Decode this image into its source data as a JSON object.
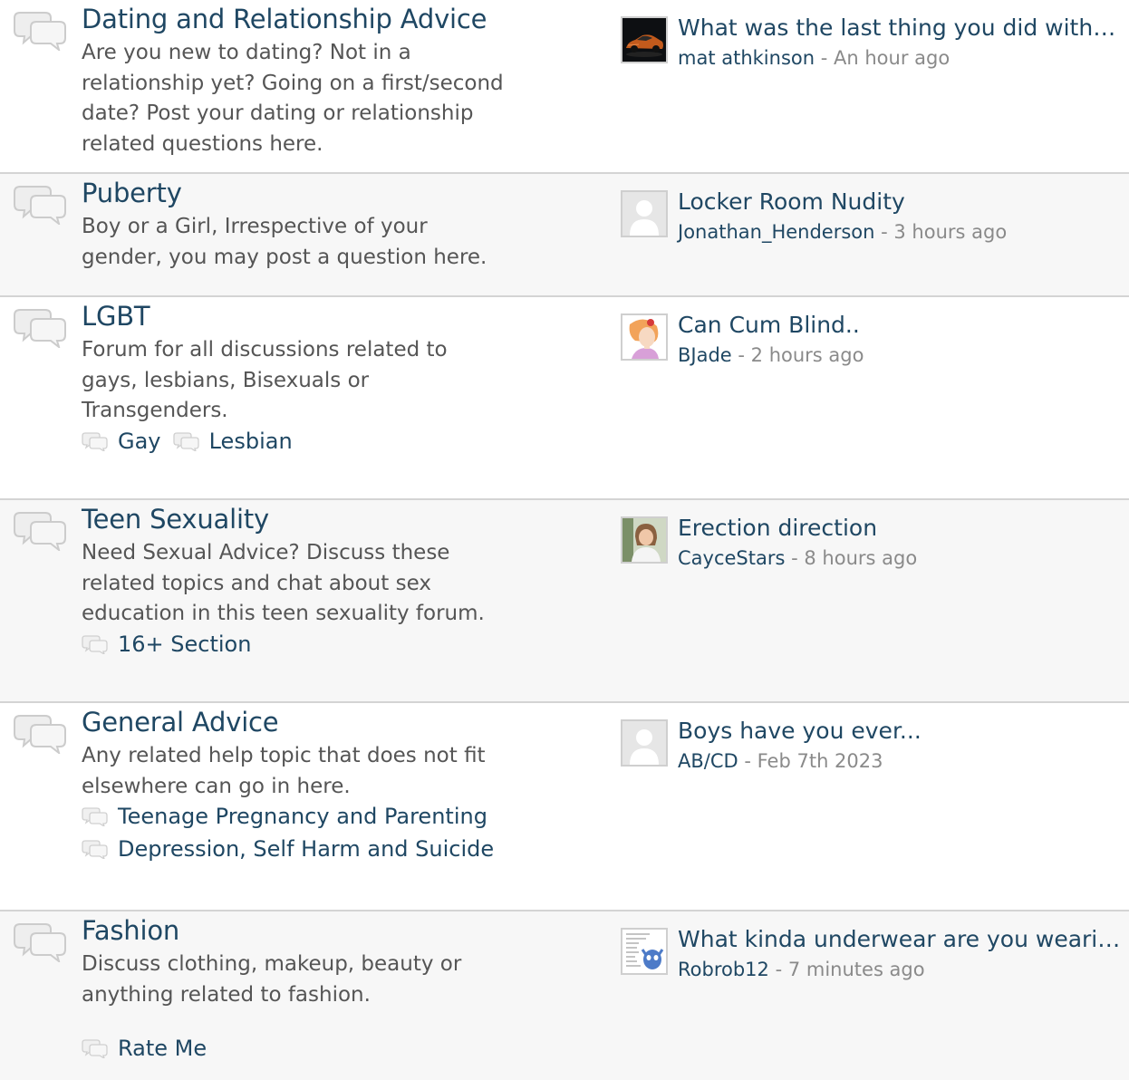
{
  "forums": [
    {
      "title": "Dating and Relationship Advice",
      "description": "Are you new to dating? Not in a relationship yet? Going on a first/second date? Post your dating or relationship related questions here.",
      "subforums": [],
      "last_post": {
        "title": "What was the last thing you did with yo...",
        "user": "mat athkinson",
        "separator": " - ",
        "time": "An hour ago",
        "avatar": "car-avatar"
      }
    },
    {
      "title": "Puberty",
      "description": "Boy or a Girl, Irrespective of your gender, you may post a question here.",
      "subforums": [],
      "last_post": {
        "title": "Locker Room Nudity",
        "user": "Jonathan_Henderson",
        "separator": " - ",
        "time": "3 hours ago",
        "avatar": "default-avatar"
      }
    },
    {
      "title": "LGBT",
      "description": "Forum for all discussions related to gays, lesbians, Bisexuals or Transgenders.",
      "subforums": [
        "Gay",
        "Lesbian"
      ],
      "last_post": {
        "title": "Can Cum Blind..",
        "user": "BJade",
        "separator": " - ",
        "time": "2 hours ago",
        "avatar": "cartoon-avatar"
      }
    },
    {
      "title": "Teen Sexuality",
      "description": "Need Sexual Advice? Discuss these related topics and chat about sex education in this teen sexuality forum.",
      "subforums": [
        "16+ Section"
      ],
      "last_post": {
        "title": "Erection direction",
        "user": "CayceStars",
        "separator": " - ",
        "time": "8 hours ago",
        "avatar": "photo-avatar"
      }
    },
    {
      "title": "General Advice",
      "description": "Any related help topic that does not fit elsewhere can go in here.",
      "subforums": [
        "Teenage Pregnancy and Parenting",
        "Depression, Self Harm and Suicide"
      ],
      "last_post": {
        "title": "Boys have you ever...",
        "user": "AB/CD",
        "separator": " - ",
        "time": "Feb 7th 2023",
        "avatar": "default-avatar"
      }
    },
    {
      "title": "Fashion",
      "description": "Discuss clothing, makeup, beauty or anything related to fashion.",
      "subforums": [
        "Rate Me"
      ],
      "last_post": {
        "title": "What kinda underwear are you wearing?...",
        "user": "Robrob12",
        "separator": " - ",
        "time": "7 minutes ago",
        "avatar": "meme-avatar"
      }
    }
  ],
  "colors": {
    "link": "#1f4763",
    "text": "#555555",
    "meta": "#8a8a8a",
    "divider": "#d4d4d4",
    "alt_row": "#f7f7f7"
  }
}
